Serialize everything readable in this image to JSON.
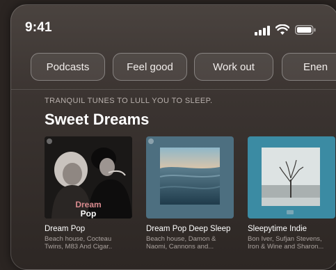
{
  "status_bar": {
    "time": "9:41"
  },
  "chips": [
    "Podcasts",
    "Feel good",
    "Work out",
    "Enen"
  ],
  "section": {
    "kicker": "TRANQUIL TUNES TO LULL YOU TO SLEEP.",
    "title": "Sweet Dreams"
  },
  "cards": [
    {
      "title": "Dream Pop",
      "subtitle_line1": "Beach house, Cocteau",
      "subtitle_line2": "Twins, M83 And Cigar..",
      "cover_text_1": "Dream",
      "cover_text_2": "Pop"
    },
    {
      "title": "Dream Pop Deep Sleep",
      "subtitle_line1": "Beach house, Damon &",
      "subtitle_line2": "Naomi, Cannons and..."
    },
    {
      "title": "Sleepytime Indie",
      "subtitle_line1": "Bon Iver, Sufjan Stevens,",
      "subtitle_line2": "Iron & Wine and Sharon..."
    }
  ]
}
